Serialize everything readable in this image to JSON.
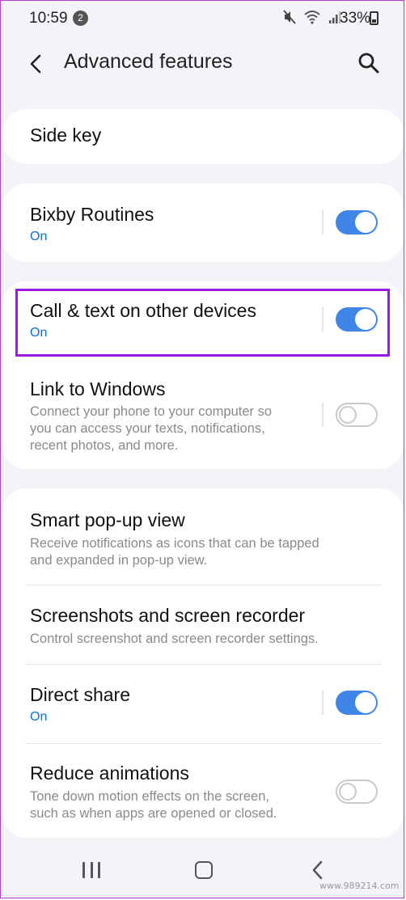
{
  "status_bar": {
    "time": "10:59",
    "notification_count": "2",
    "battery": "33%"
  },
  "app_bar": {
    "title": "Advanced features"
  },
  "items": {
    "side_key": {
      "title": "Side key"
    },
    "bixby": {
      "title": "Bixby Routines",
      "status": "On",
      "enabled": true
    },
    "call_text": {
      "title": "Call & text on other devices",
      "status": "On",
      "enabled": true
    },
    "link_windows": {
      "title": "Link to Windows",
      "desc1": "Connect your phone to your computer so",
      "desc2": "you can access your texts, notifications,",
      "desc3": "recent photos, and more.",
      "enabled": false
    },
    "smart_popup": {
      "title": "Smart pop-up view",
      "desc1": "Receive notifications as icons that can be tapped",
      "desc2": "and expanded in pop-up view."
    },
    "screenshots": {
      "title": "Screenshots and screen recorder",
      "desc1": "Control screenshot and screen recorder settings."
    },
    "direct_share": {
      "title": "Direct share",
      "status": "On",
      "enabled": true
    },
    "reduce_anim": {
      "title": "Reduce animations",
      "desc1": "Tone down motion effects on the screen,",
      "desc2": "such as when apps are opened or closed.",
      "enabled": false
    }
  },
  "colors": {
    "accent": "#3f86e8",
    "highlight": "#a218e0",
    "background": "#f4f3f8"
  },
  "watermark": "www.989214.com"
}
